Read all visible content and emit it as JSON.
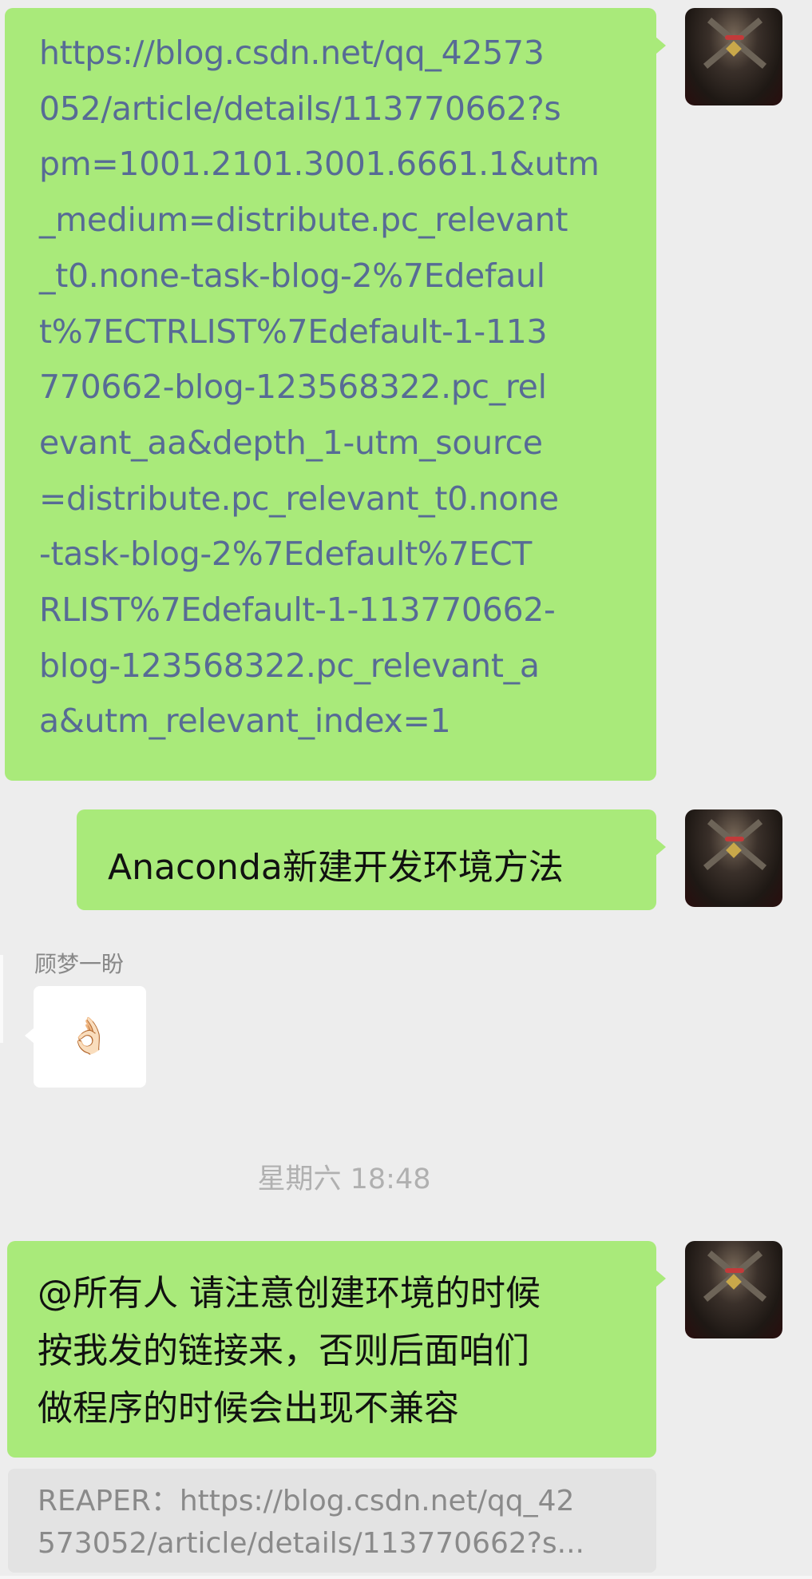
{
  "messages": [
    {
      "sender": "self",
      "type": "link",
      "lines": [
        "https://blog.csdn.net/qq_42573",
        "052/article/details/113770662?s",
        "pm=1001.2101.3001.6661.1&utm",
        "_medium=distribute.pc_relevant",
        "_t0.none-task-blog-2%7Edefaul",
        "t%7ECTRLIST%7Edefault-1-113",
        "770662-blog-123568322.pc_rel",
        "evant_aa&depth_1-utm_source",
        "=distribute.pc_relevant_t0.none",
        "-task-blog-2%7Edefault%7ECT",
        "RLIST%7Edefault-1-113770662-",
        "blog-123568322.pc_relevant_a",
        "a&utm_relevant_index=1"
      ]
    },
    {
      "sender": "self",
      "text": "Anaconda新建开发环境方法"
    },
    {
      "sender": "顾梦一盼",
      "text": "👌🏻"
    },
    {
      "sender": "self",
      "lines": [
        "@所有人 请注意创建环境的时候",
        "按我发的链接来，否则后面咱们",
        "做程序的时候会出现不兼容"
      ],
      "quote": {
        "lines": [
          "REAPER：https://blog.csdn.net/qq_42",
          "573052/article/details/113770662?s..."
        ]
      }
    }
  ],
  "timestamp": "星期六 18:48",
  "colors": {
    "bubble_self": "#a9ea7a",
    "bubble_other": "#ffffff",
    "link": "#576b95",
    "background": "#ededed",
    "quote_bg": "#e3e3e3"
  }
}
